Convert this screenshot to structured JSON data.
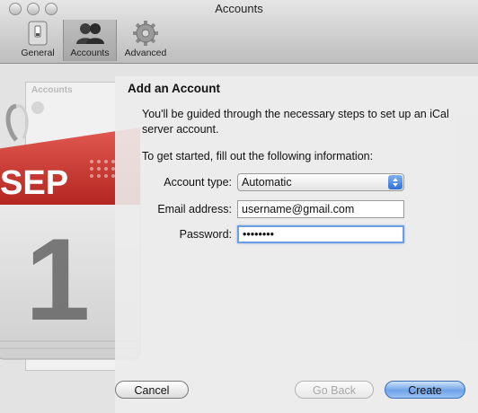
{
  "window": {
    "title": "Accounts"
  },
  "toolbar": {
    "items": [
      {
        "label": "General",
        "icon": "switch-icon"
      },
      {
        "label": "Accounts",
        "icon": "people-icon",
        "selected": true
      },
      {
        "label": "Advanced",
        "icon": "gear-icon"
      }
    ]
  },
  "background": {
    "calendar_month": "SEP",
    "calendar_day": "1"
  },
  "sheet": {
    "title": "Add an Account",
    "intro": "You'll be guided through the necessary steps to set up an iCal server account.",
    "fillout": "To get started, fill out the following information:",
    "fields": {
      "account_type": {
        "label": "Account type:",
        "value": "Automatic"
      },
      "email": {
        "label": "Email address:",
        "value": "username@gmail.com"
      },
      "password": {
        "label": "Password:",
        "value": "••••••••"
      }
    }
  },
  "buttons": {
    "cancel": "Cancel",
    "go_back": "Go Back",
    "create": "Create"
  },
  "colors": {
    "accent": "#2f6fd8",
    "calendar_red": "#c8312c"
  }
}
